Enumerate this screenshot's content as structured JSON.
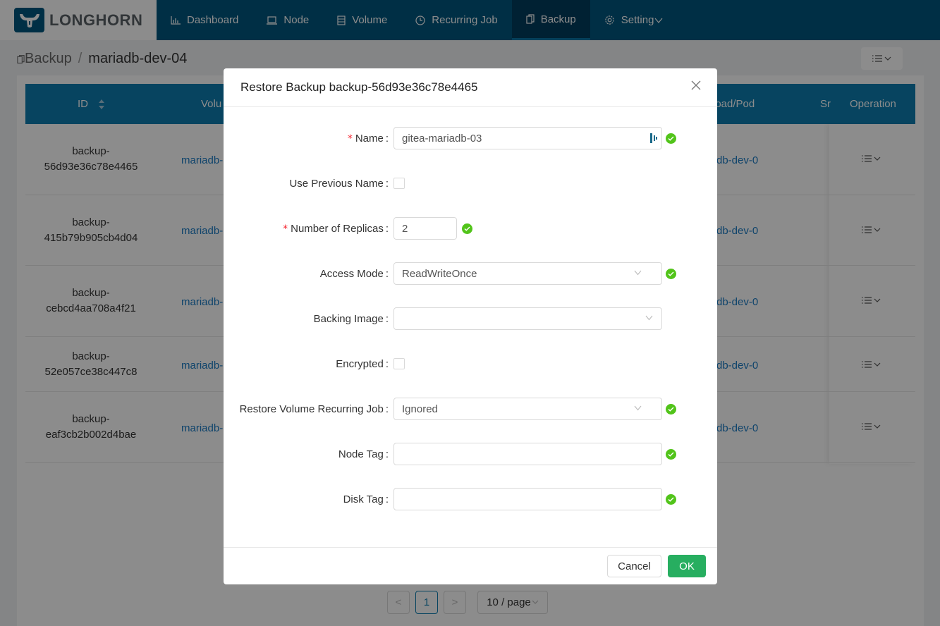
{
  "app": {
    "brand": "LONGHORN"
  },
  "nav": {
    "items": [
      {
        "label": "Dashboard",
        "icon": "bar-chart-icon"
      },
      {
        "label": "Node",
        "icon": "laptop-icon"
      },
      {
        "label": "Volume",
        "icon": "database-icon"
      },
      {
        "label": "Recurring Job",
        "icon": "clock-icon"
      },
      {
        "label": "Backup",
        "icon": "copy-icon",
        "active": true
      },
      {
        "label": "Setting",
        "icon": "gear-icon",
        "has_dropdown": true
      }
    ]
  },
  "breadcrumb": {
    "parent": "Backup",
    "separator": "/",
    "current": "mariadb-dev-04"
  },
  "table": {
    "headers": {
      "id": "ID",
      "volume": "Volu",
      "workload_pod": "load/Pod",
      "snapshot": "Sr",
      "operation": "Operation"
    },
    "rows": [
      {
        "id_line1": "backup-",
        "id_line2": "56d93e36c78e4465",
        "volume": "mariadb-",
        "pod": "db-dev-0"
      },
      {
        "id_line1": "backup-",
        "id_line2": "415b79b905cb4d04",
        "volume": "mariadb-",
        "pod": "db-dev-0"
      },
      {
        "id_line1": "backup-",
        "id_line2": "cebcd4aa708a4f21",
        "volume": "mariadb-",
        "pod": "db-dev-0"
      },
      {
        "id_line1": "backup-",
        "id_line2": "52e057ce38c447c8",
        "volume": "mariadb-",
        "pod": "db-dev-0"
      },
      {
        "id_line1": "backup-",
        "id_line2": "eaf3cb2b002d4bae",
        "volume": "mariadb-",
        "pod": "db-dev-0"
      }
    ]
  },
  "pagination": {
    "prev": "<",
    "current_page": "1",
    "next": ">",
    "page_size": "10 / page"
  },
  "modal": {
    "title": "Restore Backup backup-56d93e36c78e4465",
    "fields": {
      "name": {
        "label": "Name",
        "required": true,
        "value": "gitea-mariadb-03",
        "valid": true
      },
      "use_previous_name": {
        "label": "Use Previous Name",
        "checked": false
      },
      "replicas": {
        "label": "Number of Replicas",
        "required": true,
        "value": "2",
        "valid": true
      },
      "access_mode": {
        "label": "Access Mode",
        "value": "ReadWriteOnce",
        "valid": true
      },
      "backing_image": {
        "label": "Backing Image",
        "value": ""
      },
      "encrypted": {
        "label": "Encrypted",
        "checked": false
      },
      "recurring_job": {
        "label": "Restore Volume Recurring Job",
        "value": "Ignored",
        "valid": true
      },
      "node_tag": {
        "label": "Node Tag",
        "value": "",
        "valid": true
      },
      "disk_tag": {
        "label": "Disk Tag",
        "value": "",
        "valid": true
      }
    },
    "buttons": {
      "cancel": "Cancel",
      "ok": "OK"
    }
  },
  "colors": {
    "header": "#00577e",
    "table_header": "#0e7db0",
    "ok_button": "#27ae60",
    "valid": "#52c41a",
    "required": "#f5222d",
    "link": "#1a7bc4"
  },
  "req_mark": "*",
  "colon": ":"
}
